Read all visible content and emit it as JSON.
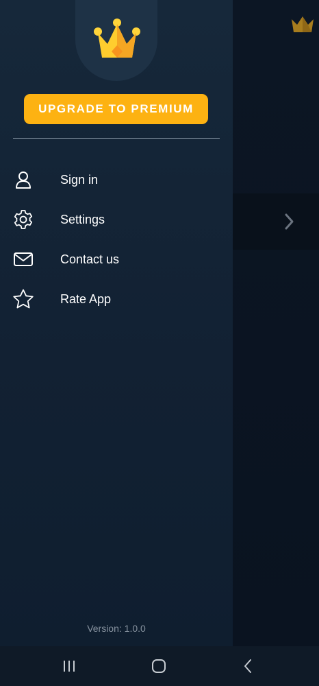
{
  "drawer": {
    "upgrade_label": "UPGRADE TO PREMIUM",
    "menu": [
      {
        "label": "Sign in",
        "icon": "user-icon"
      },
      {
        "label": "Settings",
        "icon": "gear-icon"
      },
      {
        "label": "Contact us",
        "icon": "mail-icon"
      },
      {
        "label": "Rate App",
        "icon": "star-icon"
      }
    ],
    "version": "Version: 1.0.0"
  },
  "background": {
    "header_icon": "crown-icon",
    "row_icon": "chevron-right-icon"
  },
  "navbar": {
    "recents_icon": "recents-icon",
    "home_icon": "home-icon",
    "back_icon": "back-icon"
  },
  "colors": {
    "accent": "#fdb212",
    "drawer_bg": "#142436",
    "text": "#ffffff",
    "muted": "#8893a0"
  }
}
